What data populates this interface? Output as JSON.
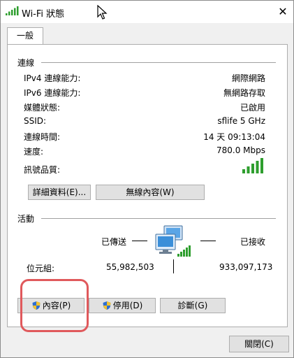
{
  "window": {
    "title": "Wi-Fi 狀態",
    "close_glyph": "✕"
  },
  "tab": {
    "label": "一般"
  },
  "connection": {
    "heading": "連線",
    "rows": [
      {
        "label": "IPv4 連線能力:",
        "value": "網際網路"
      },
      {
        "label": "IPv6 連線能力:",
        "value": "無網路存取"
      },
      {
        "label": "媒體狀態:",
        "value": "已啟用"
      },
      {
        "label": "SSID:",
        "value": "sflife 5 GHz"
      },
      {
        "label": "連線時間:",
        "value": "14 天 09:13:04"
      },
      {
        "label": "速度:",
        "value": "780.0 Mbps"
      }
    ],
    "signal_label": "訊號品質:",
    "signal_bars": 5,
    "details_button": "詳細資料(E)...",
    "wireless_props_button": "無線內容(W)"
  },
  "activity": {
    "heading": "活動",
    "sent_label": "已傳送",
    "received_label": "已接收",
    "bytes_label": "位元組:",
    "bytes_sent": "55,982,503",
    "bytes_received": "933,097,173"
  },
  "buttons": {
    "properties": "內容(P)",
    "disable": "停用(D)",
    "diagnose": "診斷(G)",
    "close": "關閉(C)"
  },
  "colors": {
    "signal_green": "#2e9e2e",
    "highlight_red": "#e0595c",
    "shield_blue": "#2f6fd1",
    "shield_yellow": "#f2c230"
  }
}
